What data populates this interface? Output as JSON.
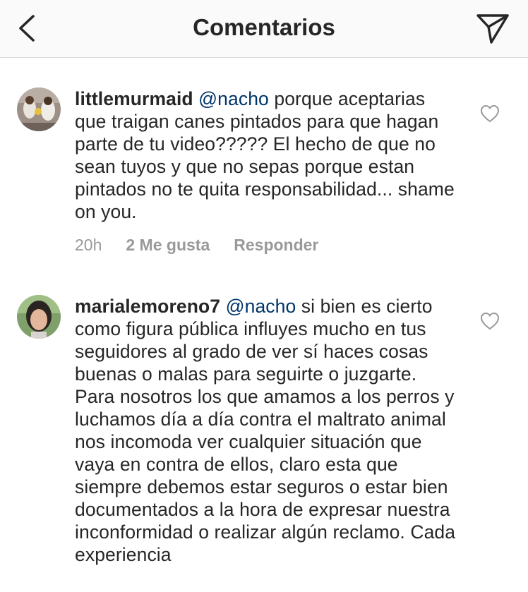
{
  "header": {
    "title": "Comentarios"
  },
  "comments": [
    {
      "username": "littlemurmaid",
      "mention": "@nacho",
      "text": " porque aceptarias que traigan canes pintados para que hagan parte de tu video????? El hecho de que no sean tuyos y que no sepas porque estan pintados no te quita responsabilidad... shame on you.",
      "time": "20h",
      "likes": "2 Me gusta",
      "reply": "Responder",
      "avatar_icon": "user-photo-avatar",
      "like_icon": "heart-outline-icon"
    },
    {
      "username": "marialemoreno7",
      "mention": "@nacho",
      "text": "  si bien es cierto  como figura pública influyes mucho en tus seguidores al grado de ver sí haces cosas buenas o malas para seguirte o juzgarte. Para nosotros los que amamos a los perros y luchamos día a día contra el  maltrato animal nos incomoda ver cualquier situación que vaya en contra de ellos, claro esta que siempre debemos estar seguros  o estar bien documentados a la hora de expresar nuestra inconformidad o realizar algún reclamo. Cada experiencia",
      "avatar_icon": "user-photo-avatar",
      "like_icon": "heart-outline-icon"
    }
  ],
  "colors": {
    "text": "#262626",
    "mention": "#003569",
    "meta": "#999999",
    "header_bg": "#fafafa",
    "divider": "#dbdbdb"
  }
}
